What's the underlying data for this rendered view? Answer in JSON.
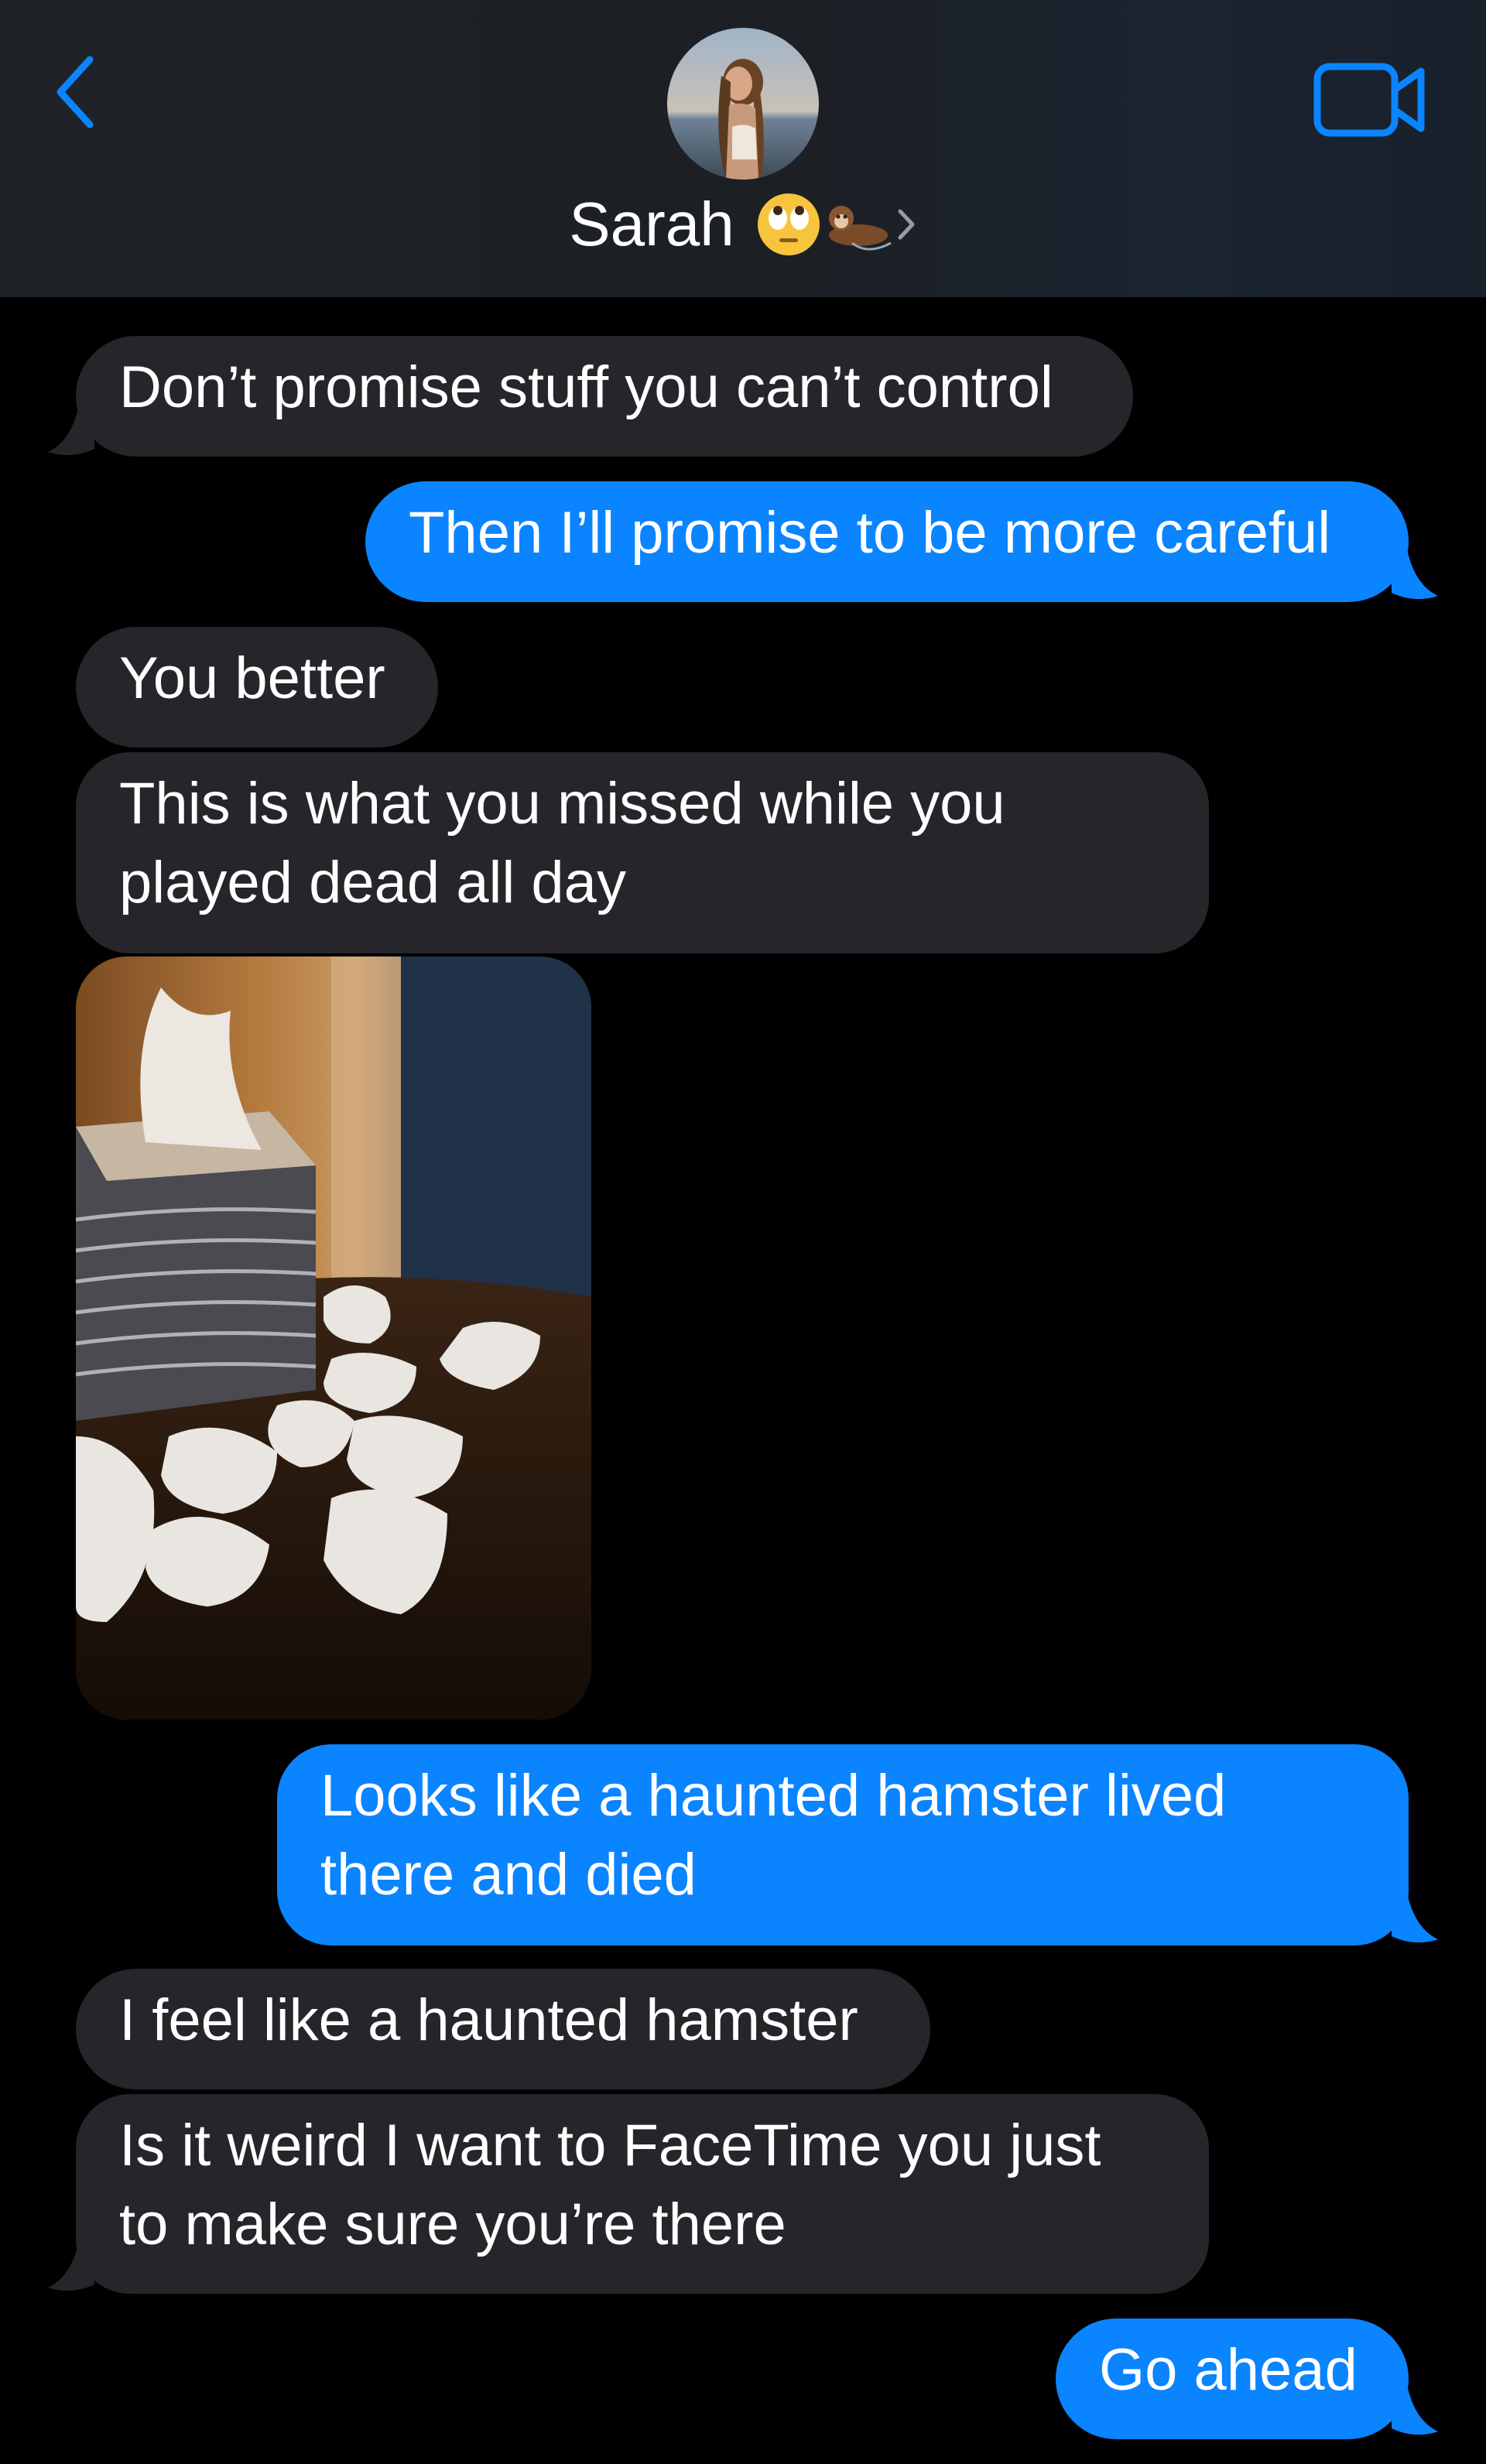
{
  "header": {
    "contact_name": "Sarah",
    "name_emojis": [
      "eye-roll-emoji",
      "otter-emoji"
    ],
    "back_icon": "chevron-left-icon",
    "video_icon": "video-camera-icon",
    "accent_color": "#0a84ff"
  },
  "messages": [
    {
      "id": "m1",
      "direction": "incoming",
      "lines": [
        "Don’t promise stuff you can’t control"
      ]
    },
    {
      "id": "m2",
      "direction": "outgoing",
      "lines": [
        "Then I’ll promise to be more careful"
      ]
    },
    {
      "id": "m3",
      "direction": "incoming",
      "lines": [
        "You better"
      ]
    },
    {
      "id": "m4",
      "direction": "incoming",
      "lines": [
        "This is what you missed while you",
        "played dead all day"
      ]
    },
    {
      "id": "m5",
      "direction": "incoming",
      "type": "photo"
    },
    {
      "id": "m6",
      "direction": "outgoing",
      "lines": [
        "Looks like a haunted hamster lived",
        "there and died"
      ]
    },
    {
      "id": "m7",
      "direction": "incoming",
      "lines": [
        "I feel like a haunted hamster"
      ]
    },
    {
      "id": "m8",
      "direction": "incoming",
      "lines": [
        "Is it weird I want to FaceTime you just",
        "to make sure you’re there"
      ]
    },
    {
      "id": "m9",
      "direction": "outgoing",
      "lines": [
        "Go ahead"
      ]
    }
  ],
  "colors": {
    "incoming_bubble": "#26252a",
    "outgoing_bubble": "#0a84ff",
    "background": "#000000"
  }
}
